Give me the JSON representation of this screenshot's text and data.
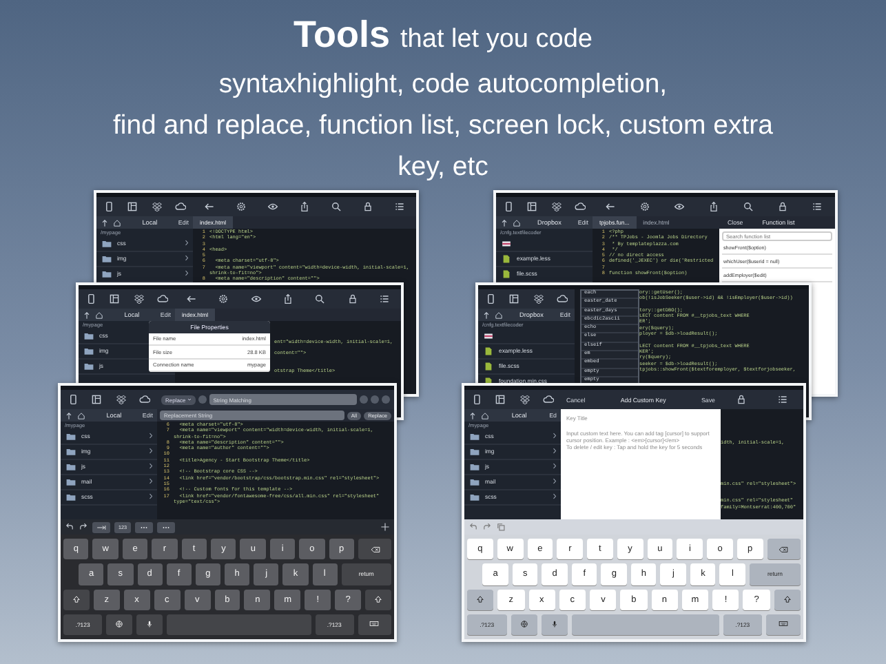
{
  "headline": {
    "bold": "Tools",
    "lead": "that let you code",
    "lines": [
      "syntaxhighlight, code autocompletion,",
      "find and replace, function list, screen lock, custom extra",
      "key, etc"
    ]
  },
  "screens": [
    {
      "sidebar": {
        "title": "Local",
        "edit": "Edit",
        "path": "/mypage",
        "items": [
          {
            "kind": "folder",
            "name": "css"
          },
          {
            "kind": "folder",
            "name": "img"
          },
          {
            "kind": "folder",
            "name": "js"
          }
        ]
      },
      "tabs": [
        {
          "label": "index.html",
          "selected": true
        }
      ],
      "code": [
        {
          "n": "1",
          "text": "<!DOCTYPE html>"
        },
        {
          "n": "2",
          "text": "<html lang=\"en\">"
        },
        {
          "n": "3"
        },
        {
          "n": "4",
          "text": "<head>"
        },
        {
          "n": "5"
        },
        {
          "n": "6",
          "text": "  <meta charset=\"utf-8\">"
        },
        {
          "n": "7",
          "text": "  <meta name=\"viewport\" content=\"width=device-width, initial-scale=1,"
        },
        {
          "text": "shrink-to-fit=no\">"
        },
        {
          "n": "8",
          "text": "  <meta name=\"description\" content=\"\">"
        }
      ]
    },
    {
      "sidebar": {
        "title": "Local",
        "edit": "Edit",
        "path": "/mypage",
        "items": [
          {
            "kind": "folder",
            "name": "css"
          },
          {
            "kind": "folder",
            "name": "img"
          },
          {
            "kind": "folder",
            "name": "js"
          }
        ]
      },
      "tabs": [
        {
          "label": "index.html",
          "selected": true
        }
      ],
      "popup": {
        "title": "File Properties",
        "rows": [
          {
            "label": "File name",
            "value": "index.html"
          },
          {
            "label": "File size",
            "value": "28.8 KB"
          },
          {
            "label": "Connection name",
            "value": "mypage"
          }
        ]
      },
      "code": [
        {
          "text": "ent=\"width=device-width, initial-scale=1,"
        },
        {
          "text": "content=\"\">"
        },
        {
          "text": "otstrap Theme</title>"
        }
      ]
    },
    {
      "sidebar": {
        "title": "Local",
        "edit": "Edit",
        "path": "/mypage",
        "items": [
          {
            "kind": "folder",
            "name": "css"
          },
          {
            "kind": "folder",
            "name": "img"
          },
          {
            "kind": "folder",
            "name": "js"
          },
          {
            "kind": "folder",
            "name": "mail"
          },
          {
            "kind": "folder",
            "name": "scss"
          }
        ]
      },
      "find": {
        "mode": "Replace",
        "search": {
          "placeholder": "String Matching"
        },
        "replacement": {
          "placeholder": "Replacement String"
        },
        "all": "All",
        "replace": "Replace"
      },
      "code": [
        {
          "n": "6",
          "text": "  <meta charset=\"utf-8\">"
        },
        {
          "n": "7",
          "text": "  <meta name=\"viewport\" content=\"width=device-width, initial-scale=1,"
        },
        {
          "text": "shrink-to-fit=no\">"
        },
        {
          "n": "8",
          "text": "  <meta name=\"description\" content=\"\">"
        },
        {
          "n": "9",
          "text": "  <meta name=\"author\" content=\"\">"
        },
        {
          "n": "10"
        },
        {
          "n": "11",
          "text": "  <title>Agency - Start Bootstrap Theme</title>"
        },
        {
          "n": "12"
        },
        {
          "n": "13",
          "text": "  <!-- Bootstrap core CSS -->"
        },
        {
          "n": "14",
          "text": "  <link href=\"vendor/bootstrap/css/bootstrap.min.css\" rel=\"stylesheet\">"
        },
        {
          "n": "15"
        },
        {
          "n": "16",
          "text": "  <!-- Custom fonts for this template -->"
        },
        {
          "n": "17",
          "text": "  <link href=\"vendor/fontawesome-free/css/all.min.css\" rel=\"stylesheet\""
        },
        {
          "text": "type=\"text/css\">"
        }
      ],
      "extra_keys": [
        {
          "kind": "undo"
        },
        {
          "kind": "redo"
        },
        {
          "kind": "tab"
        },
        {
          "kind": "text",
          "label": "123"
        },
        {
          "kind": "symbol"
        },
        {
          "kind": "symbol"
        }
      ],
      "keyboard": {
        "light": false,
        "rows": [
          [
            "q",
            "w",
            "e",
            "r",
            "t",
            "y",
            "u",
            "i",
            "o",
            "p",
            {
              "kind": "delete"
            }
          ],
          [
            {
              "kind": "indent"
            },
            "a",
            "s",
            "d",
            "f",
            "g",
            "h",
            "j",
            "k",
            "l",
            {
              "kind": "return",
              "label": "return"
            }
          ],
          [
            {
              "kind": "shift"
            },
            "z",
            "x",
            "c",
            "v",
            "b",
            "n",
            "m",
            "!",
            "?",
            {
              "kind": "shift"
            }
          ],
          [
            {
              "kind": "mode",
              "label": ".?123"
            },
            {
              "kind": "globe"
            },
            {
              "kind": "mic"
            },
            {
              "kind": "space"
            },
            {
              "kind": "mode",
              "label": ".?123"
            },
            {
              "kind": "hide"
            }
          ]
        ]
      }
    },
    {
      "sidebar": {
        "title": "Dropbox",
        "edit": "Edit",
        "path": "/cnfg.textfilecoder",
        "items": [
          {
            "kind": "image"
          },
          {
            "kind": "file",
            "name": "example.less"
          },
          {
            "kind": "file",
            "name": "file.scss"
          }
        ]
      },
      "tabs": [
        {
          "label": "tpjobs.fun...",
          "selected": true
        },
        {
          "label": "index.html",
          "selected": false
        }
      ],
      "function_list": {
        "close": "Close",
        "title": "Function list",
        "search": {
          "placeholder": "Search function list"
        },
        "items": [
          "showFront($option)",
          "whichUser($userid = null)",
          "addEmployer($edit)"
        ]
      },
      "code": [
        {
          "n": "1",
          "text": "<?php"
        },
        {
          "n": "2",
          "text": "/** TPJobs - Joomla Jobs Directory"
        },
        {
          "n": "3",
          "text": " * By templateplazza.com"
        },
        {
          "n": "4",
          "text": " */"
        },
        {
          "n": "5",
          "text": "// no direct access"
        },
        {
          "n": "6",
          "text": "defined('_JEXEC') or die('Restricted"
        },
        {
          "n": "7"
        },
        {
          "n": "8",
          "text": "function showFront($option)"
        }
      ]
    },
    {
      "fullscreen_editor": true,
      "sidebar": {
        "title": "Dropbox",
        "edit": "Edit",
        "path": "/cnfg.textfilecoder",
        "items": [
          {
            "kind": "image"
          },
          {
            "kind": "file",
            "name": "example.less"
          },
          {
            "kind": "file",
            "name": "file.scss"
          },
          {
            "kind": "file",
            "name": "foundation.min.css"
          }
        ]
      },
      "autocomplete": [
        "each",
        "easter_date",
        "easter_days",
        "ebcdic2ascii",
        "echo",
        "else",
        "elseif",
        "em",
        "embed",
        "empty",
        "empty"
      ],
      "code": [
        {
          "text": "ory::getUser();"
        },
        {
          "text": "ob(!isJobSeeker($user->id) && !isEmployer($user->id))"
        },
        {
          "text": "tory::getDBO();"
        },
        {
          "text": "LECT content FROM #__tpjobs_text WHERE"
        },
        {
          "text": "ER';"
        },
        {
          "text": "ery($query);"
        },
        {
          "text": "ployer = $db->loadResult();"
        },
        {
          "text": "LECT content FROM #__tpjobs_text WHERE"
        },
        {
          "text": "KER';"
        },
        {
          "text": "ry($query);"
        },
        {
          "text": "seeker = $db->loadResult();"
        },
        {
          "text": "tpjobs::showFront($textforemployer, $textforjobseeker,"
        }
      ]
    },
    {
      "sidebar": {
        "title": "Local",
        "edit": "Ed",
        "path": "/mypage",
        "items": [
          {
            "kind": "folder",
            "name": "css"
          },
          {
            "kind": "folder",
            "name": "img"
          },
          {
            "kind": "folder",
            "name": "js"
          },
          {
            "kind": "folder",
            "name": "mail"
          },
          {
            "kind": "folder",
            "name": "scss"
          }
        ]
      },
      "custom_key": {
        "cancel": "Cancel",
        "title": "Add Custom Key",
        "save": "Save",
        "key_title": {
          "placeholder": "Key Title"
        },
        "content": {
          "placeholder": "Input custom text here. You can add tag [cursor] to support cursor position. Example : <em>[cursor]</em>\nTo delete / edit key : Tap and hold the key for 5 seconds"
        }
      },
      "code": [
        {
          "text": "idth, initial-scale=1,"
        },
        {
          "text": "min.css\" rel=\"stylesheet\">"
        },
        {
          "text": "min.css\" rel=\"stylesheet\""
        },
        {
          "text": "family=Montserrat:400,700\""
        }
      ],
      "extra_keys": [
        {
          "kind": "undo"
        },
        {
          "kind": "redo"
        },
        {
          "kind": "copy"
        }
      ],
      "keyboard": {
        "light": true,
        "rows": [
          [
            "q",
            "w",
            "e",
            "r",
            "t",
            "y",
            "u",
            "i",
            "o",
            "p",
            {
              "kind": "delete"
            }
          ],
          [
            {
              "kind": "indent"
            },
            "a",
            "s",
            "d",
            "f",
            "g",
            "h",
            "j",
            "k",
            "l",
            {
              "kind": "return",
              "label": "return"
            }
          ],
          [
            {
              "kind": "shift"
            },
            "z",
            "x",
            "c",
            "v",
            "b",
            "n",
            "m",
            "!",
            "?",
            {
              "kind": "shift"
            }
          ],
          [
            {
              "kind": "mode",
              "label": ".?123"
            },
            {
              "kind": "globe"
            },
            {
              "kind": "mic"
            },
            {
              "kind": "space"
            },
            {
              "kind": "mode",
              "label": ".?123"
            },
            {
              "kind": "hide"
            }
          ]
        ]
      }
    }
  ]
}
